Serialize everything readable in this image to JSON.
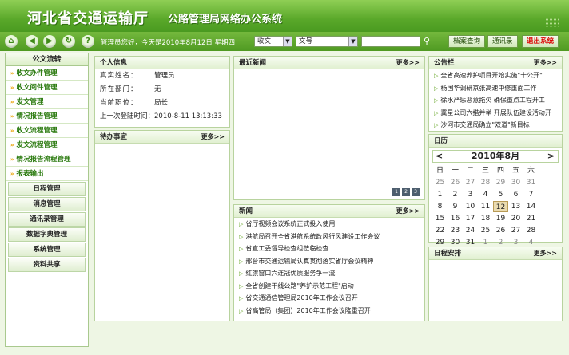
{
  "header": {
    "title": "河北省交通运输厅",
    "subtitle": "公路管理局网络办公系统"
  },
  "toolbar": {
    "user_info": "管理员您好，今天是2010年8月12日 星期四",
    "select1": "收文",
    "select2": "文号",
    "search_placeholder": "",
    "btn_archive": "档案查询",
    "btn_contacts": "通讯录",
    "btn_logout": "退出系统"
  },
  "sidebar": {
    "head": "公文流转",
    "items": [
      "收文办件管理",
      "收文阅件管理",
      "发文管理",
      "情况报告管理",
      "收文流程管理",
      "发文流程管理",
      "情况报告流程管理",
      "报表输出"
    ],
    "cats": [
      "日程管理",
      "消息管理",
      "通讯录管理",
      "数据字典管理",
      "系统管理",
      "资料共享"
    ]
  },
  "personal": {
    "title": "个人信息",
    "rows": [
      {
        "label": "真实姓名：",
        "value": "管理员"
      },
      {
        "label": "所在部门：",
        "value": "无"
      },
      {
        "label": "当前职位：",
        "value": "局长"
      },
      {
        "label": "上一次登陆时间：",
        "value": "2010-8-11 13:13:33"
      }
    ]
  },
  "todo": {
    "title": "待办事宜",
    "more": "更多>>"
  },
  "latest": {
    "title": "最近新闻",
    "more": "更多>>",
    "pages": [
      "1",
      "2",
      "3"
    ]
  },
  "news": {
    "title": "新闻",
    "more": "更多>>",
    "items": [
      "省厅视频会议系统正式投入使用",
      "港航局召开全省港航系统政风行风建设工作会议",
      "省直工委督导检查组莅临检查",
      "邢台市交通运输局认真贯彻落实省厅会议精神",
      "红旗窗口六连冠优质服务争一流",
      "全省创建干线公路\"养护示范工程\"启动",
      "省交通通信管理局2010年工作会议召开",
      "省高管局（集团）2010年工作会议隆重召开"
    ]
  },
  "notice": {
    "title": "公告栏",
    "more": "更多>>",
    "items": [
      "全省高速养护项目开始实施\"十公开\"",
      "杨国华调研京张高速中修重面工作",
      "徐水严惩恶意拖欠 确保重点工程开工",
      "冀星公司六措并举 开展队伍建设活动开",
      "沙河市交通局确立\"双道\"新目标"
    ]
  },
  "calendar": {
    "title": "日历",
    "month": "2010年8月",
    "prev": "<",
    "next": ">",
    "weekdays": [
      "日",
      "一",
      "二",
      "三",
      "四",
      "五",
      "六"
    ],
    "days": [
      "25",
      "26",
      "27",
      "28",
      "29",
      "30",
      "31",
      "1",
      "2",
      "3",
      "4",
      "5",
      "6",
      "7",
      "8",
      "9",
      "10",
      "11",
      "12",
      "13",
      "14",
      "15",
      "16",
      "17",
      "18",
      "19",
      "20",
      "21",
      "22",
      "23",
      "24",
      "25",
      "26",
      "27",
      "28",
      "29",
      "30",
      "31",
      "1",
      "2",
      "3",
      "4"
    ],
    "today": "12"
  },
  "schedule": {
    "title": "日程安排",
    "more": "更多>>"
  }
}
